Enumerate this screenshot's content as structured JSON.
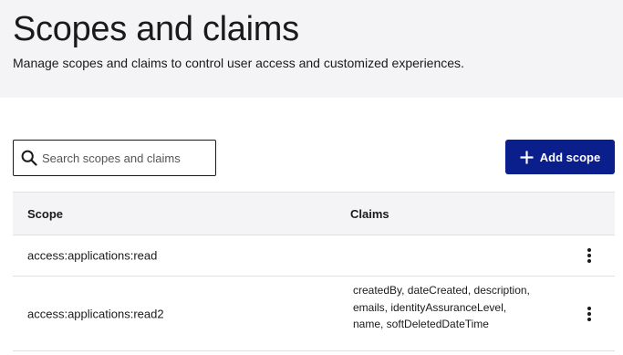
{
  "header": {
    "title": "Scopes and claims",
    "subtitle": "Manage scopes and claims to control user access and customized experiences."
  },
  "toolbar": {
    "search_placeholder": "Search scopes and claims",
    "search_value": "",
    "search_icon": "search-icon",
    "add_label": "Add scope",
    "add_icon": "plus-icon",
    "add_color": "#0a1e8c"
  },
  "table": {
    "columns": [
      "Scope",
      "Claims"
    ],
    "rows": [
      {
        "scope": "access:applications:read",
        "claims": ""
      },
      {
        "scope": "access:applications:read2",
        "claims": "createdBy, dateCreated, description, emails, identityAssuranceLevel, name, softDeletedDateTime"
      }
    ],
    "row_action_icon": "kebab-menu-icon"
  }
}
